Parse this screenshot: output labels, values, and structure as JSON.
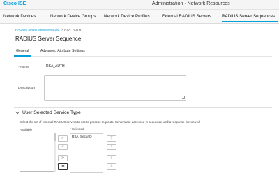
{
  "header": {
    "app_name": "Cisco ISE",
    "title": "Administration · Network Resources"
  },
  "nav_tabs": [
    {
      "label": "Network Devices"
    },
    {
      "label": "Network Device Groups"
    },
    {
      "label": "Network Device Profiles"
    },
    {
      "label": "External RADIUS Servers"
    },
    {
      "label": "RADIUS Server Sequences",
      "active": true
    }
  ],
  "breadcrumb": {
    "parent": "RADIUS Server Sequences List",
    "separator": ">",
    "current": "RSA_AUTH"
  },
  "page_title": "RADIUS Server Sequence",
  "sub_tabs": [
    {
      "label": "General",
      "active": true
    },
    {
      "label": "Advanced Attribute Settings"
    }
  ],
  "form": {
    "name_label": "* Name",
    "name_value": "RSA_AUTH",
    "description_label": "Description",
    "description_value": ""
  },
  "section": {
    "chevron": "chevron-down-icon",
    "title": "User Selected Service Type",
    "description": "Select the set of external RADIUS servers to use to process requests. Servers are accessed in sequence until a response is received",
    "available_label": "Available",
    "selected_label": "* Selected",
    "selected_items": [
      "RSA_SecurID"
    ]
  },
  "buttons": {
    "move_right": ">",
    "move_left": "<",
    "move_all_right": "≫",
    "move_all_left": "≪",
    "up_top": "⊼",
    "up": "∧",
    "down": "∨",
    "down_bottom": "⊻"
  },
  "colors": {
    "accent": "#049fd9"
  }
}
